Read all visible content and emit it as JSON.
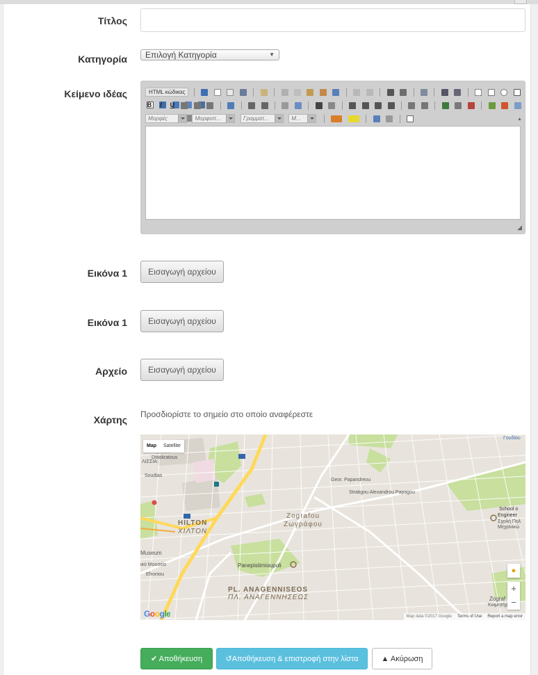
{
  "form": {
    "title_label": "Τίτλος",
    "title_value": "",
    "category_label": "Κατηγορία",
    "category_selected": "Επιλογή Κατηγορία",
    "idea_text_label": "Κείμενο ιδέας",
    "image1_label": "Εικόνα 1",
    "image2_label": "Εικόνα 1",
    "file_label": "Αρχείο",
    "file_button_label": "Εισαγωγή αρχείου",
    "map_label": "Χάρτης",
    "map_hint": "Προσδιορίστε το σημείο στο οποίο αναφέρεστε"
  },
  "editor": {
    "source_label": "HTML κώδικας",
    "combo_styles": "Μορφές",
    "combo_format": "Μορφοπ...",
    "combo_font": "Γραμματ...",
    "combo_size": "Μ...",
    "bold": "B",
    "italic": "I",
    "underline": "U"
  },
  "map": {
    "type_map": "Map",
    "type_satellite": "Satellite",
    "labels": {
      "zografou_latin": "Zografou",
      "zografou_greek": "Ζωγράφου",
      "hilton_latin": "HILTON",
      "hilton_greek": "ΧΙΛΤΟΝ",
      "pl_latin": "PL. ANAGENNISEOS",
      "pl_greek": "ΠΛ. ΑΝΑΓΕΝΝΗΣΕΩΣ",
      "panepistimioupoli": "Panepistimioupoli",
      "school": "School o",
      "engineer": "Engineer",
      "school_greek": "Σχολή Πολ",
      "mixan": "Μηχανικώ",
      "museum": "Museum",
      "goudi": "Γουδίου",
      "ilissia": "ΛΙΣΣΙΑ",
      "zograf_sm": "Zograf",
      "koimitiri": "Κοιμητήρι",
      "efronio": "Efroniou",
      "papandreou": "Geor. Papandreou",
      "stratigou": "Stratigou Alexandrou Papagou",
      "dinokratous": "Dinokratous",
      "soudias": "Soudias",
      "mousio": "ικό Μουσείο"
    },
    "zoom_in": "+",
    "zoom_out": "−",
    "google": "Google",
    "footer_data": "Map data ©2017 Google",
    "footer_terms": "Terms of Use",
    "footer_report": "Report a map error"
  },
  "actions": {
    "save": "Αποθήκευση",
    "save_back": "Αποθήκευση & επιστροφή στην λίστα",
    "cancel": "Ακύρωση"
  },
  "colors": {
    "save_green": "#45ad5b",
    "info_blue": "#5bc0de",
    "map_park": "#c8df9e",
    "map_road_major": "#ffe07a"
  },
  "icons": {
    "save_icon": "check",
    "save_back_icon": "undo",
    "cancel_icon": "warning"
  }
}
